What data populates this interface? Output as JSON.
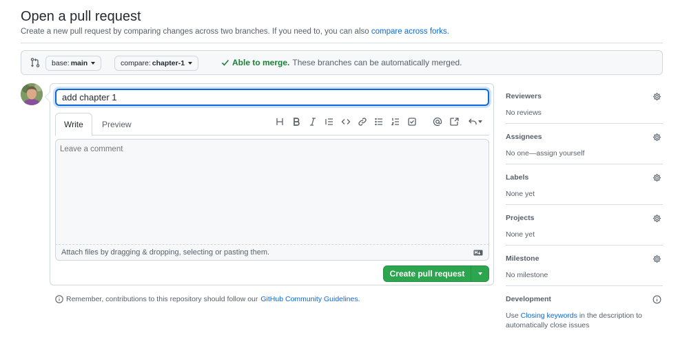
{
  "header": {
    "title": "Open a pull request",
    "subtitle": "Create a new pull request by comparing changes across two branches. If you need to, you can also",
    "subtitle_link": "compare across forks."
  },
  "compare": {
    "base_prefix": "base:",
    "base_branch": "main",
    "compare_prefix": "compare:",
    "compare_branch": "chapter-1",
    "status_ok": "Able to merge.",
    "status_text": "These branches can be automatically merged."
  },
  "form": {
    "title_value": "add chapter 1",
    "tab_write": "Write",
    "tab_preview": "Preview",
    "comment_placeholder": "Leave a comment",
    "attach_text": "Attach files by dragging & dropping, selecting or pasting them.",
    "create_label": "Create pull request",
    "toolbar_icons": [
      "heading-icon",
      "bold-icon",
      "italic-icon",
      "quote-icon",
      "code-icon",
      "link-icon",
      "unordered-list-icon",
      "ordered-list-icon",
      "task-list-icon",
      "mention-icon",
      "reference-icon",
      "reply-icon"
    ]
  },
  "footer_note": {
    "text": "Remember, contributions to this repository should follow our",
    "link": "GitHub Community Guidelines."
  },
  "sidebar": {
    "reviewers": {
      "title": "Reviewers",
      "value": "No reviews"
    },
    "assignees": {
      "title": "Assignees",
      "value": "No one—assign yourself"
    },
    "labels": {
      "title": "Labels",
      "value": "None yet"
    },
    "projects": {
      "title": "Projects",
      "value": "None yet"
    },
    "milestone": {
      "title": "Milestone",
      "value": "No milestone"
    },
    "development": {
      "title": "Development",
      "value_prefix": "Use",
      "value_link": "Closing keywords",
      "value_suffix": "in the description to automatically close issues"
    }
  },
  "colors": {
    "accent": "#0969da",
    "success": "#2da44e",
    "ok_text": "#1a7f37"
  }
}
